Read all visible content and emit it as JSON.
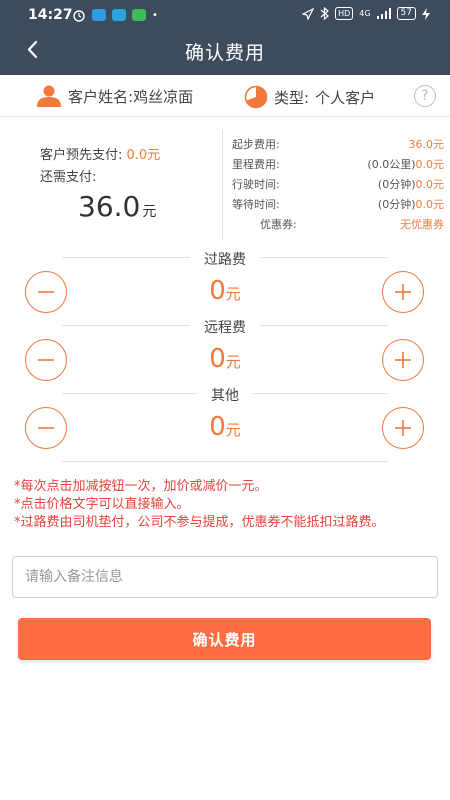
{
  "status_bar": {
    "time": "14:27",
    "network_label": "HD",
    "network_type": "4G",
    "battery": "57"
  },
  "header": {
    "title": "确认费用"
  },
  "customer": {
    "name_label": "客户姓名:",
    "name": "鸡丝凉面",
    "type_label": "类型:",
    "type": "个人客户",
    "help_icon": "?"
  },
  "payment": {
    "prepaid_label": "客户预先支付:",
    "prepaid_value": "0.0元",
    "remaining_label": "还需支付:",
    "total": "36.0",
    "total_unit": "元"
  },
  "details": {
    "items": [
      {
        "label": "起步费用:",
        "value": "36.0元",
        "value_prefix": ""
      },
      {
        "label": "里程费用:",
        "value": "0.0元",
        "value_prefix": "(0.0公里)"
      },
      {
        "label": "行驶时间:",
        "value": "0.0元",
        "value_prefix": "(0分钟)"
      },
      {
        "label": "等待时间:",
        "value": "0.0元",
        "value_prefix": "(0分钟)"
      },
      {
        "label": "优惠券:",
        "value": "无优惠券",
        "value_prefix": ""
      }
    ]
  },
  "fees": [
    {
      "label": "过路费",
      "value": "0",
      "unit": "元"
    },
    {
      "label": "远程费",
      "value": "0",
      "unit": "元"
    },
    {
      "label": "其他",
      "value": "0",
      "unit": "元"
    }
  ],
  "notes": [
    "*每次点击加减按钮一次，加价或减价一元。",
    "*点击价格文字可以直接输入。",
    "*过路费由司机垫付，公司不参与提成，优惠券不能抵扣过路费。"
  ],
  "remark": {
    "placeholder": "请输入备注信息",
    "value": ""
  },
  "confirm_button": {
    "label": "确认费用"
  },
  "colors": {
    "header_bg": "#3d4b5c",
    "accent": "#f07a3c",
    "button": "#ff6e42",
    "note_red": "#e8423c"
  },
  "icons": {
    "back": "chevron-left-icon",
    "person": "person-icon",
    "type": "pie-chart-icon",
    "minus": "minus-icon",
    "plus": "plus-icon"
  }
}
